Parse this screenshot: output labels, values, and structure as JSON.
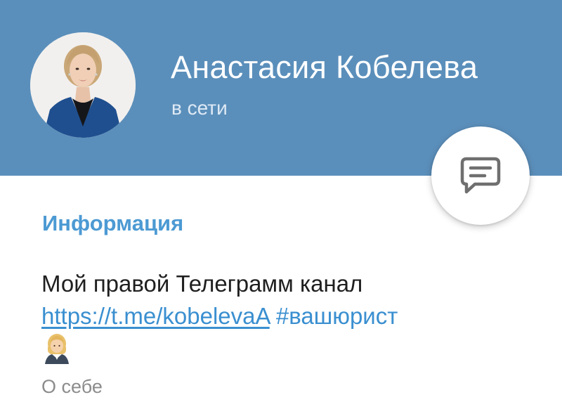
{
  "profile": {
    "name": "Анастасия Кобелева",
    "status": "в сети"
  },
  "info": {
    "section_title": "Информация",
    "bio_text": "Мой правой Телеграмм канал",
    "bio_link": "https://t.me/kobelevaA",
    "bio_hashtag": "#вашюрист",
    "bio_emoji": "woman-office-worker-emoji",
    "bio_caption": "О себе"
  },
  "actions": {
    "message_button_icon": "message-icon"
  },
  "colors": {
    "header_bg": "#5b8fbb",
    "accent": "#4c9ad3",
    "link": "#3a8fd0"
  }
}
